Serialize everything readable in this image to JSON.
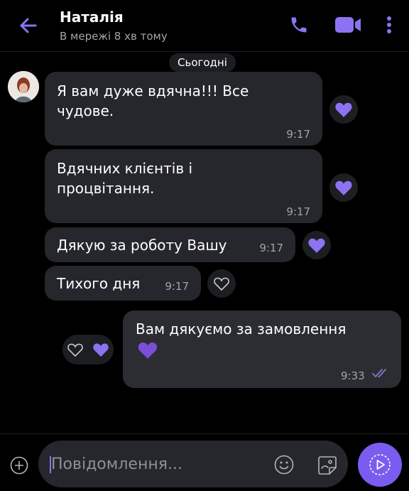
{
  "header": {
    "contact_name": "Наталія",
    "status": "В мережі 8 хв тому",
    "icons": [
      "back-arrow-icon",
      "phone-icon",
      "video-camera-icon",
      "more-vertical-icon"
    ]
  },
  "date_divider": "Сьогодні",
  "messages": [
    {
      "direction": "in",
      "text_lines": [
        "Я вам дуже вдячна!!! Все",
        "чудове."
      ],
      "time": "9:17",
      "reaction": "heart-filled"
    },
    {
      "direction": "in",
      "text_lines": [
        "Вдячних клієнтів і",
        "процвітання."
      ],
      "time": "9:17",
      "reaction": "heart-filled"
    },
    {
      "direction": "in",
      "text_lines": [
        "Дякую за роботу Вашу"
      ],
      "time": "9:17",
      "reaction": "heart-filled"
    },
    {
      "direction": "in",
      "text_lines": [
        "Тихого дня"
      ],
      "time": "9:17",
      "reaction": "heart-outline"
    },
    {
      "direction": "out",
      "text_lines": [
        "Вам дякуємо за замовлення"
      ],
      "emoji": "purple-heart",
      "time": "9:33",
      "status": "read-double-check",
      "reactions": [
        "heart-outline",
        "heart-filled"
      ]
    }
  ],
  "composer": {
    "placeholder": "Повідомлення...",
    "icons": [
      "plus-icon",
      "emoji-icon",
      "sticker-icon",
      "send-icon"
    ]
  },
  "colors": {
    "accent": "#8d73f2",
    "background": "#000000",
    "bubble": "#26272c",
    "muted_text": "#a4a4ab"
  }
}
